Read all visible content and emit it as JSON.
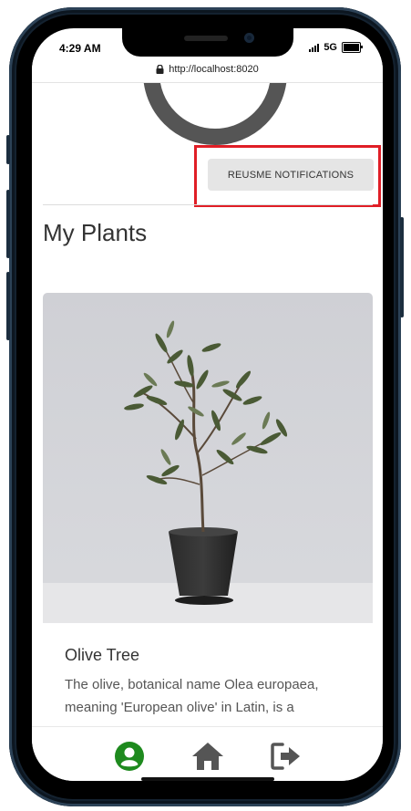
{
  "status": {
    "time": "4:29 AM",
    "network": "5G"
  },
  "browser": {
    "url": "http://localhost:8020"
  },
  "notifications": {
    "resume_label": "REUSME NOTIFICATIONS"
  },
  "page": {
    "title": "My Plants"
  },
  "plants": [
    {
      "name": "Olive Tree",
      "description": "The olive, botanical name Olea europaea, meaning 'European olive' in Latin, is a"
    }
  ],
  "nav": {
    "items": [
      "profile-icon",
      "home-icon",
      "logout-icon"
    ],
    "active_color": "#1e8a1e",
    "inactive_color": "#555555"
  },
  "colors": {
    "highlight": "#e01e26"
  }
}
